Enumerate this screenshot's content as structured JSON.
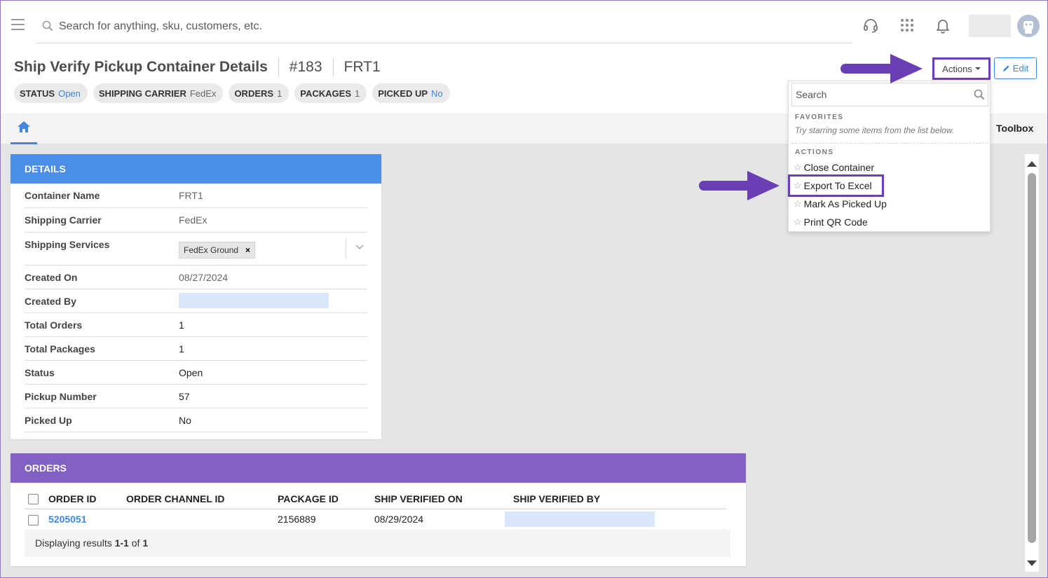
{
  "search": {
    "placeholder": "Search for anything, sku, customers, etc."
  },
  "header": {
    "title": "Ship Verify Pickup Container Details",
    "id": "#183",
    "name": "FRT1",
    "actions_label": "Actions",
    "edit_label": "Edit"
  },
  "badges": [
    {
      "label": "STATUS",
      "value": "Open"
    },
    {
      "label": "SHIPPING CARRIER",
      "value": "FedEx"
    },
    {
      "label": "ORDERS",
      "value": "1"
    },
    {
      "label": "PACKAGES",
      "value": "1"
    },
    {
      "label": "PICKED UP",
      "value": "No"
    }
  ],
  "tabs": {
    "toolbox": "Toolbox"
  },
  "details": {
    "heading": "DETAILS",
    "rows": [
      {
        "label": "Container Name",
        "value": "FRT1"
      },
      {
        "label": "Shipping Carrier",
        "value": "FedEx"
      },
      {
        "label": "Shipping Services",
        "value": "FedEx Ground"
      },
      {
        "label": "Created On",
        "value": "08/27/2024"
      },
      {
        "label": "Created By",
        "value": ""
      },
      {
        "label": "Total Orders",
        "value": "1"
      },
      {
        "label": "Total Packages",
        "value": "1"
      },
      {
        "label": "Status",
        "value": "Open"
      },
      {
        "label": "Pickup Number",
        "value": "57"
      },
      {
        "label": "Picked Up",
        "value": "No"
      }
    ]
  },
  "orders": {
    "heading": "ORDERS",
    "columns": [
      "ORDER ID",
      "ORDER CHANNEL ID",
      "PACKAGE ID",
      "SHIP VERIFIED ON",
      "SHIP VERIFIED BY"
    ],
    "rows": [
      {
        "order_id": "5205051",
        "channel_id": "",
        "package_id": "2156889",
        "verified_on": "08/29/2024",
        "verified_by": ""
      }
    ],
    "footer": {
      "prefix": "Displaying results ",
      "range": "1-1",
      "of": " of ",
      "total": "1"
    }
  },
  "dropdown": {
    "search_placeholder": "Search",
    "favorites_heading": "FAVORITES",
    "favorites_hint": "Try starring some items from the list below.",
    "actions_heading": "ACTIONS",
    "items": [
      "Close Container",
      "Export To Excel",
      "Mark As Picked Up",
      "Print QR Code"
    ]
  },
  "colors": {
    "accent_blue": "#3f87e0",
    "details_header": "#4a8ee8",
    "orders_header": "#8360c3",
    "highlight_purple": "#6a3fb3"
  }
}
